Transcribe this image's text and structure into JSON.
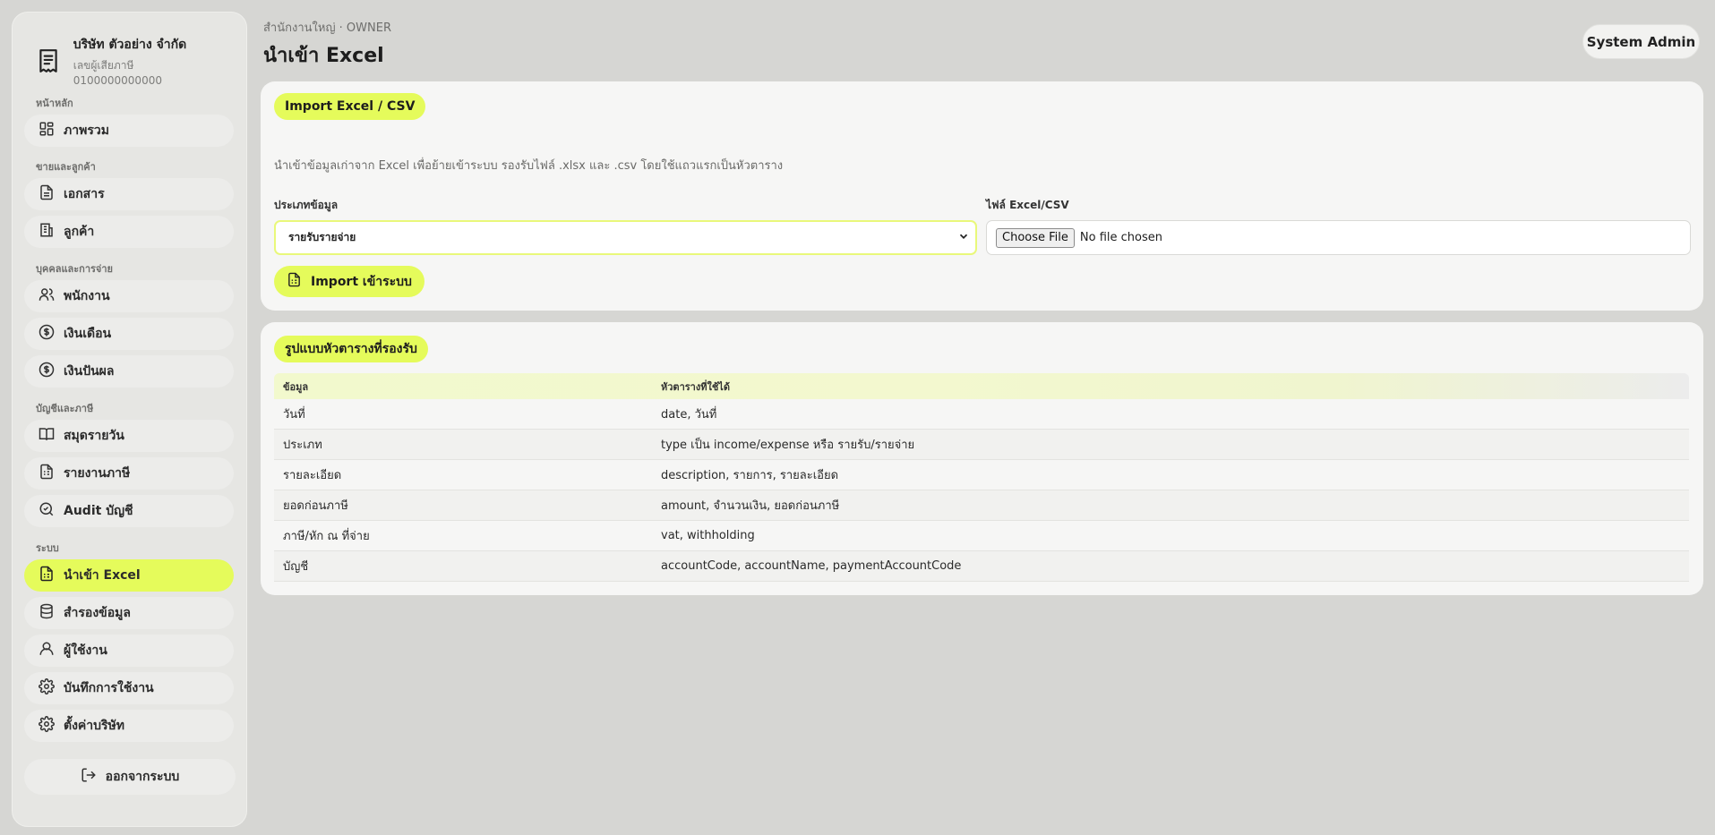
{
  "sidebar": {
    "company_name": "บริษัท ตัวอย่าง จำกัด",
    "company_tax": "เลขผู้เสียภาษี 0100000000000",
    "sections": {
      "main": "หน้าหลัก",
      "sales": "ขายและลูกค้า",
      "people": "บุคคลและการจ่าย",
      "accounting": "บัญชีและภาษี",
      "system": "ระบบ"
    },
    "items": {
      "overview": "ภาพรวม",
      "documents": "เอกสาร",
      "customers": "ลูกค้า",
      "employees": "พนักงาน",
      "salary": "เงินเดือน",
      "dividend": "เงินปันผล",
      "daybook": "สมุดรายวัน",
      "tax_report": "รายงานภาษี",
      "audit": "Audit บัญชี",
      "import_excel": "นำเข้า Excel",
      "backup": "สำรองข้อมูล",
      "users": "ผู้ใช้งาน",
      "activity_log": "บันทึกการใช้งาน",
      "company_settings": "ตั้งค่าบริษัท"
    },
    "active_item": "import_excel",
    "logout_label": "ออกจากระบบ"
  },
  "header": {
    "breadcrumb": "สำนักงานใหญ่ · OWNER",
    "title": "นำเข้า Excel",
    "user_label": "System Admin"
  },
  "import_card": {
    "title": "Import Excel / CSV",
    "description": "นำเข้าข้อมูลเก่าจาก Excel เพื่อย้ายเข้าระบบ รองรับไฟล์ .xlsx และ .csv โดยใช้แถวแรกเป็นหัวตาราง",
    "type_label": "ประเภทข้อมูล",
    "type_value": "รายรับรายจ่าย",
    "file_label": "ไฟล์ Excel/CSV",
    "choose_file_label": "Choose File",
    "no_file_label": "No file chosen",
    "import_button": "Import เข้าระบบ"
  },
  "format_card": {
    "title": "รูปแบบหัวตารางที่รองรับ",
    "columns": [
      "ข้อมูล",
      "หัวตารางที่ใช้ได้"
    ],
    "rows": [
      [
        "วันที่",
        "date, วันที่"
      ],
      [
        "ประเภท",
        "type เป็น income/expense หรือ รายรับ/รายจ่าย"
      ],
      [
        "รายละเอียด",
        "description, รายการ, รายละเอียด"
      ],
      [
        "ยอดก่อนภาษี",
        "amount, จำนวนเงิน, ยอดก่อนภาษี"
      ],
      [
        "ภาษี/หัก ณ ที่จ่าย",
        "vat, withholding"
      ],
      [
        "บัญชี",
        "accountCode, accountName, paymentAccountCode"
      ]
    ]
  },
  "colors": {
    "accent": "#e5fb5b",
    "background": "#d6d6d3",
    "card": "#f6f6f5"
  }
}
